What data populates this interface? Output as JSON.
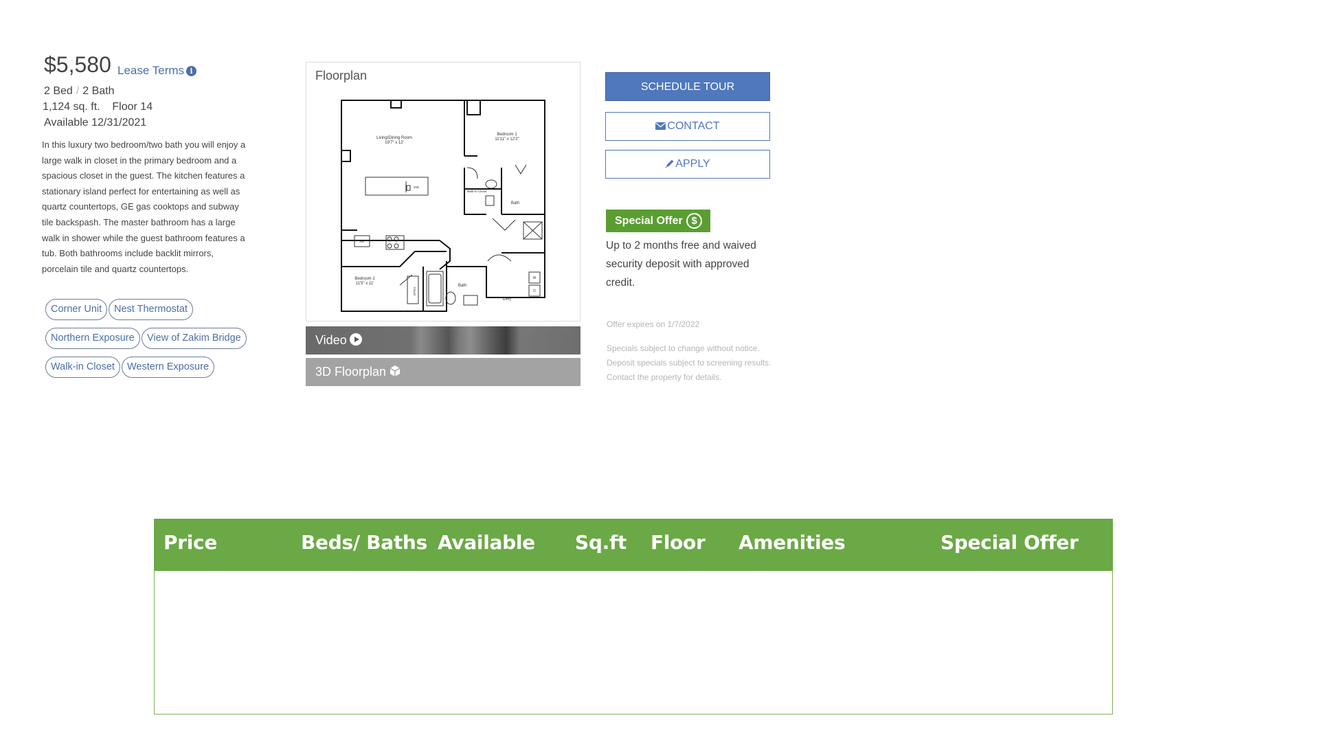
{
  "listing": {
    "price": "$5,580",
    "lease_terms_label": "Lease Terms",
    "beds": "2 Bed",
    "bed_bath_separator": "/",
    "baths": "2 Bath",
    "sqft": "1,124 sq. ft.",
    "floor": "Floor 14",
    "available": "Available 12/31/2021",
    "description": "In this luxury two bedroom/two bath you will enjoy a large walk in closet in the primary bedroom and a spacious closet in the guest. The kitchen features a stationary island perfect for entertaining as well as quartz countertops, GE gas cooktops and subway tile backspash. The master bathroom has a large walk in shower while the guest bathroom features a tub. Both bathrooms include backlit mirrors, porcelain tile and quartz countertops.",
    "tags": [
      "Corner Unit",
      "Nest Thermostat",
      "Northern Exposure",
      "View of Zakim Bridge",
      "Walk-in Closet",
      "Western Exposure"
    ]
  },
  "floorplan": {
    "title": "Floorplan",
    "rooms": {
      "living": "Living/Dining Room",
      "living_dim": "19'7\" x 12'",
      "bed1": "Bedroom 1",
      "bed1_dim": "11'11\" x 12'2\"",
      "walkin": "Walk-In Closet",
      "bath": "Bath",
      "bed2": "Bedroom 2",
      "bed2_dim": "11'5\" x 11'",
      "closet": "Closet",
      "entry": "Entry",
      "ref": "Ref",
      "dw": "DW",
      "w": "W",
      "d": "D"
    },
    "video_label": "Video",
    "floorplan3d_label": "3D Floorplan"
  },
  "actions": {
    "schedule_tour": "SCHEDULE TOUR",
    "contact": "CONTACT",
    "apply": "APPLY"
  },
  "special": {
    "badge": "Special Offer",
    "badge_icon": "$",
    "text": "Up to 2 months free and waived security deposit with approved credit.",
    "expires": "Offer expires on 1/7/2022",
    "disclaimer_1": "Specials subject to change without notice.",
    "disclaimer_2": "Deposit specials subject to screening results.",
    "disclaimer_3": "Contact the property for details."
  },
  "table": {
    "headers": [
      "Price",
      "Beds/ Baths",
      "Available",
      "Sq.ft",
      "Floor",
      "Amenities",
      "Special Offer"
    ]
  },
  "colors": {
    "link_blue": "#4a6fa5",
    "button_blue": "#4f78bd",
    "offer_green": "#5a9e32",
    "table_green": "#6aa945"
  }
}
